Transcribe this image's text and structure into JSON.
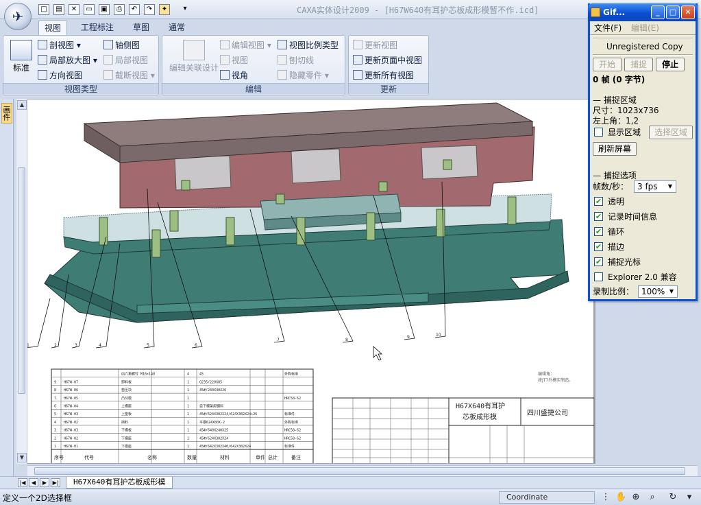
{
  "window": {
    "title": "CAXA实体设计2009 - [H67W640有耳护芯板成形模暂不作.icd]"
  },
  "ribbon": {
    "tabs": [
      "视图",
      "工程标注",
      "草图",
      "通常"
    ],
    "groups": {
      "view_type": {
        "label": "视图类型",
        "standard": "标准",
        "section_view": "剖视图",
        "axis_view": "轴侧图",
        "detail_view": "局部放大图",
        "partial_view": "局部视图",
        "direction_view": "方向视图",
        "break_view": "截断视图"
      },
      "edit": {
        "label": "编辑",
        "edit_linked_design": "编辑关联设计",
        "edit_view": "编辑视图",
        "view_scale_type": "视图比例类型",
        "view": "视图",
        "cut_line": "刨切线",
        "angle": "视角",
        "hide_part": "隐藏零件"
      },
      "update": {
        "label": "更新",
        "update_view": "更新视图",
        "update_page_views": "更新页面中视图",
        "update_all_views": "更新所有视图"
      }
    }
  },
  "left_panel": {
    "tab_label": "画件"
  },
  "drawing": {
    "callouts": [
      "1",
      "2",
      "3",
      "4",
      "5",
      "6",
      "7",
      "8",
      "9",
      "10"
    ],
    "bom_rows": [
      {
        "no": "",
        "code": "",
        "name": "内六角螺钉 M16×140",
        "qty": "4",
        "material": "45",
        "note": "外购标准"
      },
      {
        "no": "9",
        "code": "H67W-07",
        "name": "卸料板",
        "qty": "1",
        "material": "Q235/220X85",
        "note": ""
      },
      {
        "no": "8",
        "code": "H67W-06",
        "name": "垫压块",
        "qty": "1",
        "material": "45#/240X40X26",
        "note": ""
      },
      {
        "no": "7",
        "code": "H67W-05",
        "name": "凸凹模",
        "qty": "1",
        "material": "",
        "note": "HRC58-62"
      },
      {
        "no": "6",
        "code": "H67W-04",
        "name": "上模座",
        "qty": "1",
        "material": "自下模架用钢料",
        "note": ""
      },
      {
        "no": "5",
        "code": "H67W-03",
        "name": "上垫板",
        "qty": "1",
        "material": "45#/624X302X24/624X302X24+25",
        "note": "标准件"
      },
      {
        "no": "4",
        "code": "H67W-02",
        "name": "挡料",
        "qty": "1",
        "material": "平钢624X80X-2",
        "note": "外购标准"
      },
      {
        "no": "3",
        "code": "H67W-03",
        "name": "下模板",
        "qty": "1",
        "material": "45#/640X240X25",
        "note": "HRC58-62"
      },
      {
        "no": "2",
        "code": "H67W-02",
        "name": "下模座",
        "qty": "1",
        "material": "45#/624X302X24",
        "note": "HRC58-62"
      },
      {
        "no": "1",
        "code": "H67W-01",
        "name": "下模座",
        "qty": "1",
        "material": "45#/642X302X40/642X302X24",
        "note": "标准件"
      }
    ],
    "bom_header": {
      "no": "序号",
      "code": "代号",
      "name": "名称",
      "qty": "数量",
      "material": "材料",
      "unit_weight": "单件",
      "total_weight": "总计",
      "note": "备注"
    },
    "title_block": {
      "drawing_name_line1": "H67X640有耳护",
      "drawing_name_line2": "芯板成形模",
      "company": "四川盛捷公司",
      "remark_line1": "编辑角：",
      "remark_line2": "按JT7外模实制造。"
    }
  },
  "sheet_tab": "H67X640有耳护芯板成形模",
  "status": {
    "prompt": "定义一个2D选择框",
    "coordinate_label": "Coordinate"
  },
  "gif_tool": {
    "title": "Gif...",
    "menu": [
      "文件(F)",
      "编辑(E)"
    ],
    "unregistered": "Unregistered Copy",
    "buttons": {
      "start": "开始",
      "capture": "捕捉",
      "stop": "停止"
    },
    "frames_info": "0 帧 (0 字节)",
    "capture_area": {
      "heading": "捕捉区域",
      "size": "尺寸：1023x736",
      "top_left": "左上角：1,2",
      "show_area": "显示区域",
      "select_area": "选择区域",
      "refresh": "刷新屏幕"
    },
    "capture_options": {
      "heading": "捕捉选项",
      "fps_label": "帧数/秒：",
      "fps_value": "3 fps",
      "transparent": "透明",
      "record_time": "记录时间信息",
      "loop": "循环",
      "stroke": "描边",
      "capture_cursor": "捕捉光标",
      "explorer_compat": "Explorer 2.0 兼容",
      "ratio_label": "录制比例：",
      "ratio_value": "100%"
    }
  },
  "colors": {
    "upper_die": "#a26a6e",
    "lower_die": "#3e7c74",
    "top_plate": "#8f7c7d",
    "glass_plate": "#cfe0e2"
  }
}
